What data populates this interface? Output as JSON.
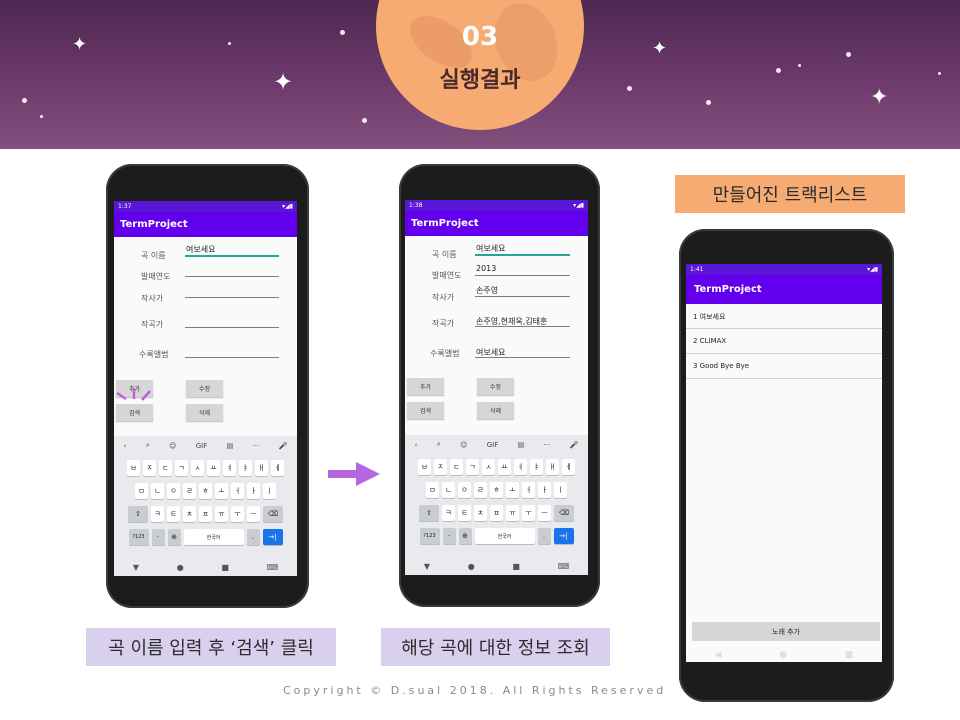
{
  "header": {
    "number": "03",
    "title": "실행결과"
  },
  "phone1": {
    "time": "1:37",
    "app_title": "TermProject",
    "fields": [
      {
        "label": "곡 이름",
        "value": "여보세요"
      },
      {
        "label": "발매연도",
        "value": ""
      },
      {
        "label": "작사가",
        "value": ""
      },
      {
        "label": "작곡가",
        "value": ""
      },
      {
        "label": "수록앨범",
        "value": ""
      }
    ],
    "buttons": {
      "add": "추가",
      "edit": "수정",
      "search": "검색",
      "delete": "삭제"
    }
  },
  "phone2": {
    "time": "1:38",
    "app_title": "TermProject",
    "fields": [
      {
        "label": "곡 이름",
        "value": "여보세요"
      },
      {
        "label": "발매연도",
        "value": "2013"
      },
      {
        "label": "작사가",
        "value": "손주영"
      },
      {
        "label": "작곡가",
        "value": "손주영,현재욱,김태훈"
      },
      {
        "label": "수록앨범",
        "value": "여보세요"
      }
    ],
    "buttons": {
      "add": "추가",
      "edit": "수정",
      "search": "검색",
      "delete": "삭제"
    }
  },
  "keyboard": {
    "toolbar": [
      "‹",
      "⌕",
      "☺",
      "GIF",
      "▤",
      "···",
      "🎤"
    ],
    "row1": [
      "ㅂ",
      "ㅈ",
      "ㄷ",
      "ㄱ",
      "ㅅ",
      "ㅛ",
      "ㅕ",
      "ㅑ",
      "ㅐ",
      "ㅔ"
    ],
    "row2": [
      "ㅁ",
      "ㄴ",
      "ㅇ",
      "ㄹ",
      "ㅎ",
      "ㅗ",
      "ㅓ",
      "ㅏ",
      "ㅣ"
    ],
    "row3": [
      "⇧",
      "ㅋ",
      "ㅌ",
      "ㅊ",
      "ㅍ",
      "ㅠ",
      "ㅜ",
      "ㅡ",
      "⌫"
    ],
    "row4": {
      "num": "?123",
      "dot": "·",
      "globe": "⊕",
      "space": "한국어",
      "period": ".",
      "enter": "→|"
    },
    "nav": [
      "▼",
      "●",
      "■",
      "⌨"
    ]
  },
  "phone3": {
    "time": "1:41",
    "app_title": "TermProject",
    "tracks": [
      "1 여보세요",
      "2 CLIMAX",
      "3 Good Bye Bye"
    ],
    "add_button": "노래 추가",
    "nav": [
      "◀",
      "●",
      "■"
    ]
  },
  "captions": {
    "left": "곡 이름 입력 후 ‘검색’ 클릭",
    "middle": "해당 곡에 대한 정보 조회",
    "right": "만들어진 트랙리스트"
  },
  "copyright": "Copyright © D.sual 2018. All Rights Reserved",
  "colors": {
    "banner": "#6d3a6b",
    "moon": "#f6ab73",
    "appbar": "#6200ee",
    "caption": "#d9d0ee",
    "arrow": "#b667e0"
  }
}
